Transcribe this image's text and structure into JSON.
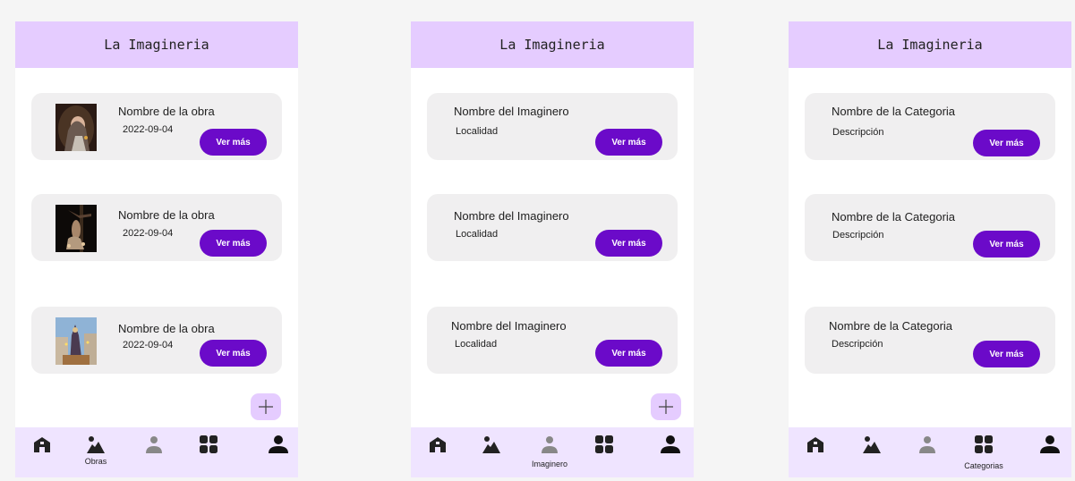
{
  "colors": {
    "appbar": "#e5ccff",
    "accent": "#6b0ac9",
    "card": "#f0eff0",
    "navbar": "#efe4ff",
    "icon": "#222222",
    "icon_inactive": "#888888"
  },
  "screens": [
    {
      "title": "La Imagineria",
      "cards": [
        {
          "name": "Nombre de la obra",
          "sub": "2022-09-04",
          "button": "Ver más",
          "thumb_icon": "virgin-portrait-image"
        },
        {
          "name": "Nombre de la obra",
          "sub": "2022-09-04",
          "button": "Ver más",
          "thumb_icon": "crucifix-image"
        },
        {
          "name": "Nombre de la obra",
          "sub": "2022-09-04",
          "button": "Ver más",
          "thumb_icon": "procession-image"
        }
      ],
      "fab_icon": "plus-icon",
      "nav": {
        "active_label": "Obras"
      }
    },
    {
      "title": "La Imagineria",
      "cards": [
        {
          "name": "Nombre del Imaginero",
          "sub": "Localidad",
          "button": "Ver más"
        },
        {
          "name": "Nombre del Imaginero",
          "sub": "Localidad",
          "button": "Ver más"
        },
        {
          "name": "Nombre del Imaginero",
          "sub": "Localidad",
          "button": "Ver más"
        }
      ],
      "fab_icon": "plus-icon",
      "nav": {
        "active_label": "Imaginero"
      }
    },
    {
      "title": "La Imagineria",
      "cards": [
        {
          "name": "Nombre de la Categoria",
          "sub": "Descripción",
          "button": "Ver más"
        },
        {
          "name": "Nombre de la Categoria",
          "sub": "Descripción",
          "button": "Ver más"
        },
        {
          "name": "Nombre de la Categoria",
          "sub": "Descripción",
          "button": "Ver más"
        }
      ],
      "nav": {
        "active_label": "Categorias"
      }
    }
  ],
  "nav_icons": [
    "home-icon",
    "landscape-icon",
    "person-icon",
    "grid-icon",
    "account-icon"
  ]
}
